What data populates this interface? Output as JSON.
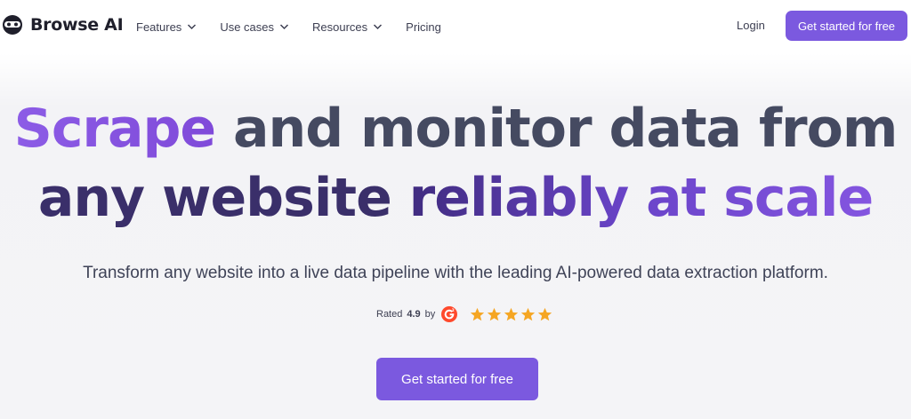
{
  "brand": {
    "name": "Browse AI"
  },
  "nav": {
    "items": [
      {
        "label": "Features",
        "has_dropdown": true
      },
      {
        "label": "Use cases",
        "has_dropdown": true
      },
      {
        "label": "Resources",
        "has_dropdown": true
      },
      {
        "label": "Pricing",
        "has_dropdown": false
      }
    ],
    "login": "Login",
    "cta": "Get started for free"
  },
  "hero": {
    "headline_line1": [
      "Scrape",
      " and monitor data from"
    ],
    "headline_line2": [
      "any website",
      " reliably at scale"
    ],
    "subtitle": "Transform any website into a live data pipeline with the leading AI-powered data extraction platform.",
    "rating": {
      "prefix": "Rated",
      "score": "4.9",
      "suffix": "by",
      "stars": 5
    },
    "cta": "Get started for free"
  },
  "colors": {
    "accent": "#7b59df",
    "star": "#f5a623",
    "g2_red": "#ff492c"
  }
}
